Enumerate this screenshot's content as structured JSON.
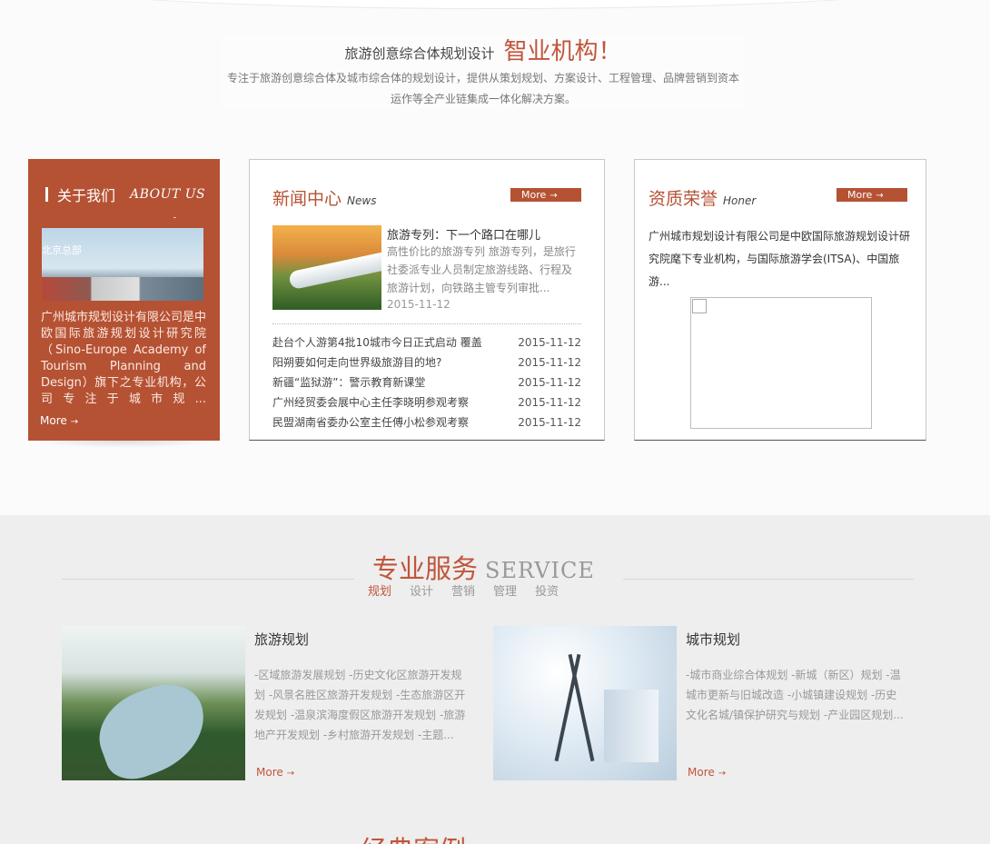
{
  "intro": {
    "small_title": "旅游创意综合体规划设计",
    "big_title": "智业机构！",
    "description": "专注于旅游创意综合体及城市综合体的规划设计，提供从策划规划、方案设计、工程管理、品牌营销到资本运作等全产业链集成一体化解决方案。"
  },
  "about": {
    "title_cn": "关于我们",
    "title_en": "ABOUT US",
    "photo_label": "北京总部",
    "text": "广州城市规划设计有限公司是中欧国际旅游规划设计研究院（Sino-Europe Academy of Tourism Planning and Design）旗下之专业机构，公司专注于城市规...",
    "more": "More",
    "more_arrow": "→"
  },
  "news": {
    "title_cn": "新闻中心",
    "title_en": "News",
    "more": "More",
    "more_arrow": "→",
    "featured": {
      "title": "旅游专列：下一个路口在哪儿",
      "desc": "高性价比的旅游专列 旅游专列，是旅行社委派专业人员制定旅游线路、行程及旅游计划，向铁路主管专列审批...",
      "date": "2015-11-12"
    },
    "items": [
      {
        "title": "赴台个人游第4批10城市今日正式启动 覆盖",
        "date": "2015-11-12"
      },
      {
        "title": "阳朔要如何走向世界级旅游目的地?",
        "date": "2015-11-12"
      },
      {
        "title": "新疆“监狱游”：警示教育新课堂",
        "date": "2015-11-12"
      },
      {
        "title": "广州经贸委会展中心主任李晓明参观考察",
        "date": "2015-11-12"
      },
      {
        "title": "民盟湖南省委办公室主任傅小松参观考察",
        "date": "2015-11-12"
      }
    ]
  },
  "honor": {
    "title_cn": "资质荣誉",
    "title_en": "Honer",
    "more": "More",
    "more_arrow": "→",
    "text": "广州城市规划设计有限公司是中欧国际旅游规划设计研究院麾下专业机构，与国际旅游学会(ITSA)、中国旅游..."
  },
  "service": {
    "title_cn": "专业服务",
    "title_en": "SERVICE",
    "tabs": [
      "规划",
      "设计",
      "营销",
      "管理",
      "投资"
    ],
    "cards": [
      {
        "title": "旅游规划",
        "desc": "-区域旅游发展规划 -历史文化区旅游开发规划 -风景名胜区旅游开发规划 -生态旅游区开发规划 -温泉滨海度假区旅游开发规划 -旅游地产开发规划 -乡村旅游开发规划 -主题...",
        "more": "More",
        "more_arrow": "→"
      },
      {
        "title": "城市规划",
        "desc": "-城市商业综合体规划 -新城（新区）规划 -温城市更新与旧城改造 -小城镇建设规划 -历史文化名城/镇保护研究与规划 -产业园区规划...",
        "more": "More",
        "more_arrow": "→"
      }
    ]
  },
  "bottom": {
    "title_partial": "经典案例"
  }
}
